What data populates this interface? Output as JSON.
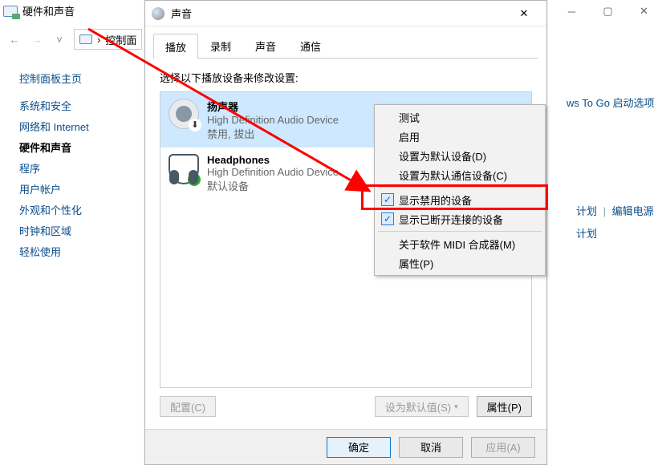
{
  "cp": {
    "title": "硬件和声音",
    "breadcrumb_item": "控制面",
    "sidebar_home": "控制面板主页",
    "sidebar_items": [
      "系统和安全",
      "网络和 Internet",
      "硬件和声音",
      "程序",
      "用户帐户",
      "外观和个性化",
      "时钟和区域",
      "轻松使用"
    ],
    "active_index": 2,
    "right_top_link": "ws To Go 启动选项",
    "right_link1": "计划",
    "right_link2": "编辑电源计划"
  },
  "dlg": {
    "title": "声音",
    "tabs": [
      "播放",
      "录制",
      "声音",
      "通信"
    ],
    "active_tab": 0,
    "instruction": "选择以下播放设备来修改设置:",
    "devices": [
      {
        "name": "扬声器",
        "driver": "High Definition Audio Device",
        "status": "禁用, 拔出"
      },
      {
        "name": "Headphones",
        "driver": "High Definition Audio Device",
        "status": "默认设备"
      }
    ],
    "btn_config": "配置(C)",
    "btn_setdefault": "设为默认值(S)",
    "btn_props": "属性(P)",
    "btn_ok": "确定",
    "btn_cancel": "取消",
    "btn_apply": "应用(A)"
  },
  "ctx": {
    "items": [
      {
        "label": "测试"
      },
      {
        "label": "启用"
      },
      {
        "label": "设置为默认设备(D)"
      },
      {
        "label": "设置为默认通信设备(C)"
      },
      {
        "sep": true
      },
      {
        "label": "显示禁用的设备",
        "checked": true
      },
      {
        "label": "显示已断开连接的设备",
        "checked": true
      },
      {
        "sep": true
      },
      {
        "label": "关于软件 MIDI 合成器(M)"
      },
      {
        "label": "属性(P)"
      }
    ]
  }
}
